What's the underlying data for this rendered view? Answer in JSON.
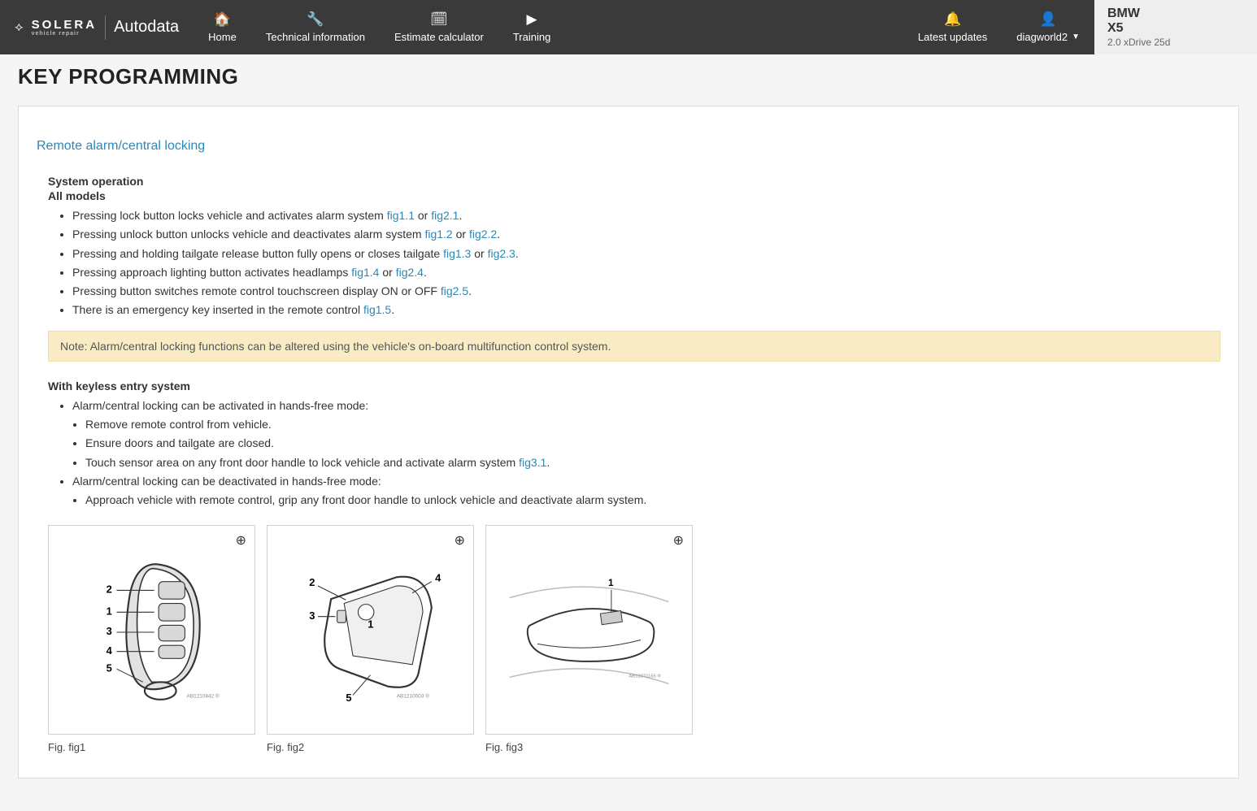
{
  "brand": {
    "solera": "SOLERA",
    "solera_sub": "vehicle repair",
    "autodata": "Autodata"
  },
  "nav": {
    "home": "Home",
    "tech": "Technical information",
    "est": "Estimate calculator",
    "train": "Training",
    "latest": "Latest updates",
    "user": "diagworld2"
  },
  "vehicle": {
    "make": "BMW",
    "model": "X5",
    "trim": "2.0 xDrive 25d"
  },
  "page": {
    "title": "KEY PROGRAMMING"
  },
  "section": {
    "heading": "Remote alarm/central locking"
  },
  "sys_op": {
    "h1": "System operation",
    "h2": "All models",
    "items": [
      {
        "pre": "Pressing lock button locks vehicle and activates alarm system ",
        "f1": "fig1.1",
        "mid": " or ",
        "f2": "fig2.1",
        "post": "."
      },
      {
        "pre": "Pressing unlock button unlocks vehicle and deactivates alarm system ",
        "f1": "fig1.2",
        "mid": " or ",
        "f2": "fig2.2",
        "post": "."
      },
      {
        "pre": "Pressing and holding tailgate release button fully opens or closes tailgate ",
        "f1": "fig1.3",
        "mid": " or ",
        "f2": "fig2.3",
        "post": "."
      },
      {
        "pre": "Pressing approach lighting button activates headlamps ",
        "f1": "fig1.4",
        "mid": " or ",
        "f2": "fig2.4",
        "post": "."
      },
      {
        "pre": "Pressing button switches remote control touchscreen display ON or OFF ",
        "f1": "fig2.5",
        "mid": "",
        "f2": "",
        "post": "."
      },
      {
        "pre": "There is an emergency key inserted in the remote control ",
        "f1": "fig1.5",
        "mid": "",
        "f2": "",
        "post": "."
      }
    ]
  },
  "note": "Note: Alarm/central locking functions can be altered using the vehicle's on-board multifunction control system.",
  "keyless": {
    "h": "With keyless entry system",
    "a": "Alarm/central locking can be activated in hands-free mode:",
    "a_sub": {
      "s1": "Remove remote control from vehicle.",
      "s2": "Ensure doors and tailgate are closed.",
      "s3_pre": "Touch sensor area on any front door handle to lock vehicle and activate alarm system ",
      "s3_f": "fig3.1",
      "s3_post": "."
    },
    "b": "Alarm/central locking can be deactivated in hands-free mode:",
    "b_sub": {
      "s1": "Approach vehicle with remote control, grip any front door handle to unlock vehicle and deactivate alarm system."
    }
  },
  "figs": {
    "c1": "Fig. fig1",
    "c2": "Fig. fig2",
    "c3": "Fig. fig3"
  }
}
